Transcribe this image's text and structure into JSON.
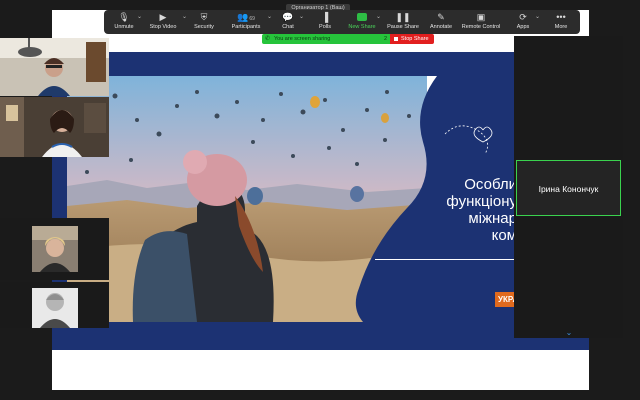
{
  "window": {
    "title": "Организатор 1 (Ваш)"
  },
  "toolbar": {
    "items": [
      {
        "label": "Unmute",
        "icon": "mic-muted-icon"
      },
      {
        "label": "Stop Video",
        "icon": "video-icon"
      },
      {
        "label": "Security",
        "icon": "shield-icon"
      },
      {
        "label": "Participants",
        "icon": "participants-icon",
        "count": "69"
      },
      {
        "label": "Chat",
        "icon": "chat-icon"
      },
      {
        "label": "Polls",
        "icon": "polls-icon"
      },
      {
        "label": "New Share",
        "icon": "new-share-icon"
      },
      {
        "label": "Pause Share",
        "icon": "pause-icon"
      },
      {
        "label": "Annotate",
        "icon": "pencil-icon"
      },
      {
        "label": "Remote Control",
        "icon": "mouse-icon"
      },
      {
        "label": "Apps",
        "icon": "apps-icon"
      },
      {
        "label": "More",
        "icon": "more-icon"
      }
    ]
  },
  "sharing": {
    "status": "You are screen sharing",
    "viewer_count": "2",
    "stop_label": "Stop Share"
  },
  "slide": {
    "title": "Особли\nфункціону\nміжнар\nком",
    "badge": "УКРА"
  },
  "participants": [
    {
      "type": "video",
      "name": ""
    },
    {
      "type": "video",
      "name": ""
    },
    {
      "type": "name",
      "name": "Ірина Конончук"
    },
    {
      "type": "video",
      "name": ""
    },
    {
      "type": "video",
      "name": ""
    }
  ],
  "colors": {
    "slide_navy": "#1c3273",
    "speaker_border": "#3ad24e",
    "share_green": "#26c43b",
    "stop_red": "#e21f1f"
  }
}
